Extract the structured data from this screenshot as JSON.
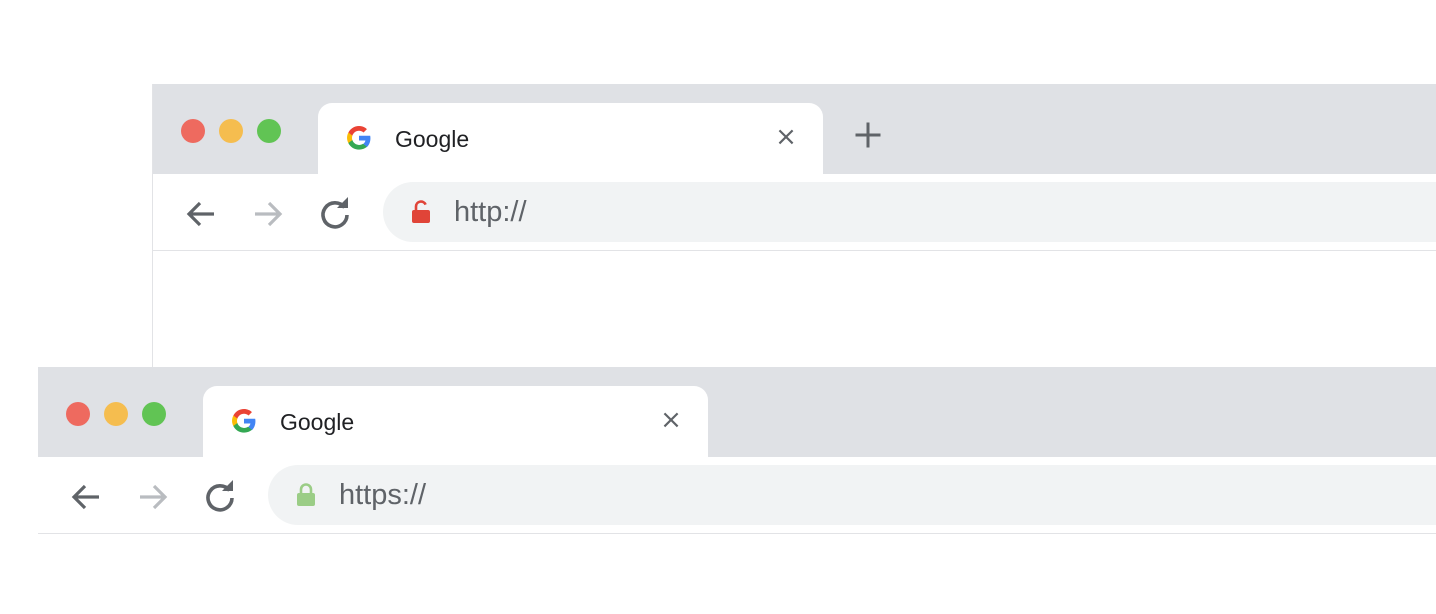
{
  "windows": [
    {
      "tab": {
        "title": "Google",
        "close_label": "×"
      },
      "new_tab_label": "+",
      "address_bar": {
        "url": "http://",
        "secure": false
      },
      "colors": {
        "lock": "#e04438"
      }
    },
    {
      "tab": {
        "title": "Google",
        "close_label": "×"
      },
      "address_bar": {
        "url": "https://",
        "secure": true
      },
      "colors": {
        "lock": "#9bcd86"
      }
    }
  ],
  "icons": {
    "favicon": "google-g-icon",
    "back": "arrow-left-icon",
    "forward": "arrow-right-icon",
    "reload": "reload-icon",
    "insecure_lock": "unlocked-padlock-icon",
    "secure_lock": "locked-padlock-icon",
    "new_tab": "plus-icon"
  }
}
